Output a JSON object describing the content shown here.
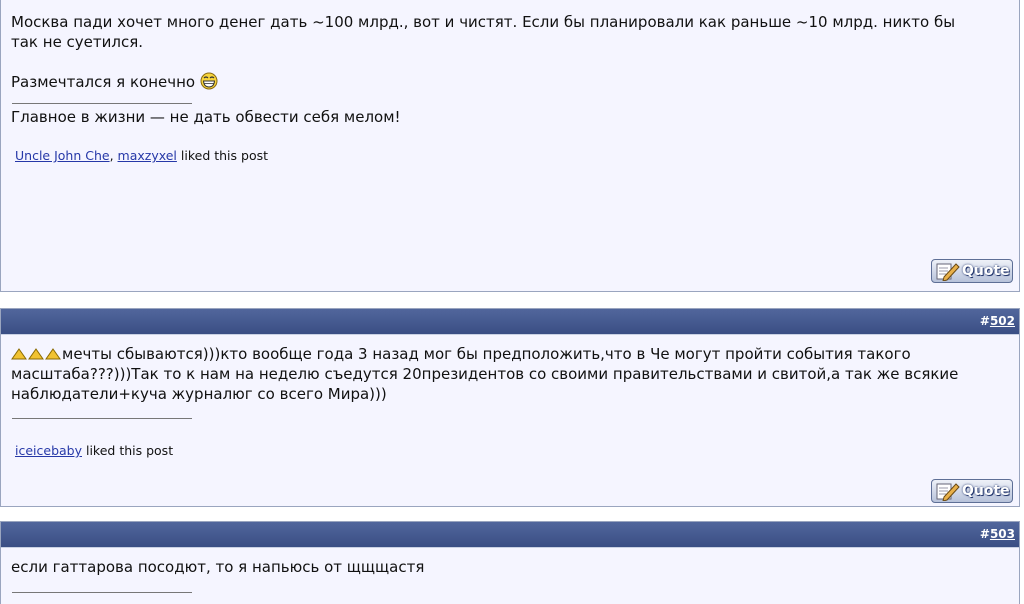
{
  "posts": [
    {
      "body_line1": "Москва пади хочет много денег дать ~100 млрд., вот и чистят. Если бы планировали как раньше ~10 млрд. никто бы",
      "body_line2": "так не суетился.",
      "body_line3": "Размечтался я конечно",
      "emoji_icon": "laughing-smiley-icon",
      "signature": "Главное в жизни — не дать обвести себя мелом!",
      "likers": [
        "Uncle John Che",
        "maxzyxel"
      ],
      "liked_text": "liked this post",
      "quote_label": "Quote"
    },
    {
      "hash": "#",
      "number": "502",
      "body_line1": "мечты сбываются)))кто вообще года 3 назад мог бы предположить,что в Че могут пройти события такого",
      "body_line2": "масштаба???)))Так то к нам на неделю съедутся 20президентов со своими правительствами и свитой,а так же всякие",
      "body_line3": "наблюдатели+куча журналюг со всего Мира)))",
      "likers": [
        "iceicebaby"
      ],
      "liked_text": "liked this post",
      "quote_label": "Quote"
    },
    {
      "hash": "#",
      "number": "503",
      "body_line1": "если гаттарова посодют, то я напьюсь от щщщастя"
    }
  ],
  "colors": {
    "header_bar": "#46598f",
    "post_bg": "#f5f5ff",
    "link": "#2638a8"
  }
}
